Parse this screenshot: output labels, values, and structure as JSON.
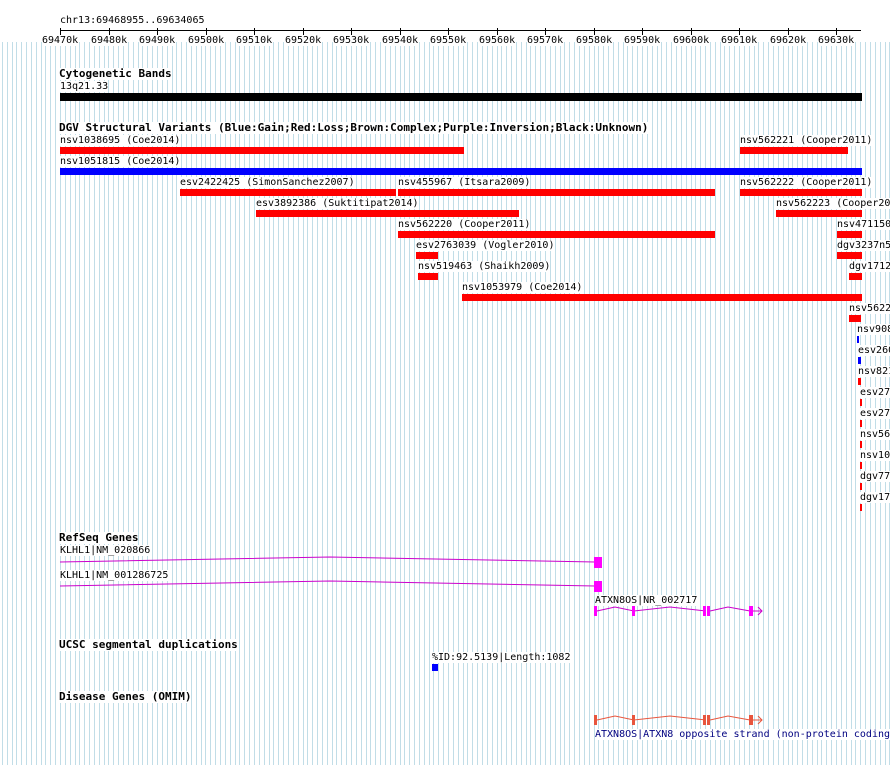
{
  "ruler": {
    "location": "chr13:69468955..69634065",
    "ticks": [
      "69470k",
      "69480k",
      "69490k",
      "69500k",
      "69510k",
      "69520k",
      "69530k",
      "69540k",
      "69550k",
      "69560k",
      "69570k",
      "69580k",
      "69590k",
      "69600k",
      "69610k",
      "69620k",
      "69630k"
    ]
  },
  "tracks": {
    "cytoband": {
      "title": "Cytogenetic Bands",
      "band": "13q21.33"
    },
    "dgv": {
      "title": "DGV Structural Variants (Blue:Gain;Red:Loss;Brown:Complex;Purple:Inversion;Black:Unknown)"
    },
    "refseq": {
      "title": "RefSeq Genes"
    },
    "segdup": {
      "title": "UCSC segmental duplications",
      "feature": "%ID:92.5139|Length:1082"
    },
    "omim": {
      "title": "Disease Genes (OMIM)",
      "feature": "ATXN8OS|ATXN8 opposite strand (non-protein coding)"
    }
  },
  "variants": [
    {
      "label": "nsv1038695 (Coe2014)",
      "color": "#ff0000"
    },
    {
      "label": "nsv562221 (Cooper2011)",
      "color": "#ff0000"
    },
    {
      "label": "nsv1051815 (Coe2014)",
      "color": "#0000ff"
    },
    {
      "label": "esv2422425 (SimonSanchez2007)",
      "color": "#ff0000"
    },
    {
      "label": "nsv455967 (Itsara2009)",
      "color": "#ff0000"
    },
    {
      "label": "nsv562222 (Cooper2011)",
      "color": "#ff0000"
    },
    {
      "label": "esv3892386 (Suktitipat2014)",
      "color": "#ff0000"
    },
    {
      "label": "nsv562223 (Cooper20",
      "color": "#ff0000"
    },
    {
      "label": "nsv562220 (Cooper2011)",
      "color": "#ff0000"
    },
    {
      "label": "nsv471150",
      "color": "#ff0000"
    },
    {
      "label": "esv2763039 (Vogler2010)",
      "color": "#ff0000"
    },
    {
      "label": "dgv3237n5",
      "color": "#ff0000"
    },
    {
      "label": "nsv519463 (Shaikh2009)",
      "color": "#ff0000"
    },
    {
      "label": "dgv1712",
      "color": "#ff0000"
    },
    {
      "label": "nsv1053979 (Coe2014)",
      "color": "#ff0000"
    },
    {
      "label": "nsv5622",
      "color": "#ff0000"
    },
    {
      "label": "nsv908",
      "color": "#0000ff"
    },
    {
      "label": "esv260",
      "color": "#0000ff"
    },
    {
      "label": "nsv821",
      "color": "#ff0000"
    },
    {
      "label": "esv27",
      "color": "#ff0000"
    },
    {
      "label": "esv27",
      "color": "#ff0000"
    },
    {
      "label": "nsv56",
      "color": "#ff0000"
    },
    {
      "label": "nsv10",
      "color": "#ff0000"
    },
    {
      "label": "dgv77",
      "color": "#ff0000"
    },
    {
      "label": "dgv17",
      "color": "#ff0000"
    }
  ],
  "genes": [
    {
      "label": "KLHL1|NM_020866"
    },
    {
      "label": "KLHL1|NM_001286725"
    },
    {
      "label": "ATXN8OS|NR_002717"
    }
  ],
  "colors": {
    "gridline": "#8fc3d4",
    "gene": "#cc00cc",
    "omim": "#e8553d",
    "omim_label": "#000080",
    "segdup": "#0000ff"
  }
}
